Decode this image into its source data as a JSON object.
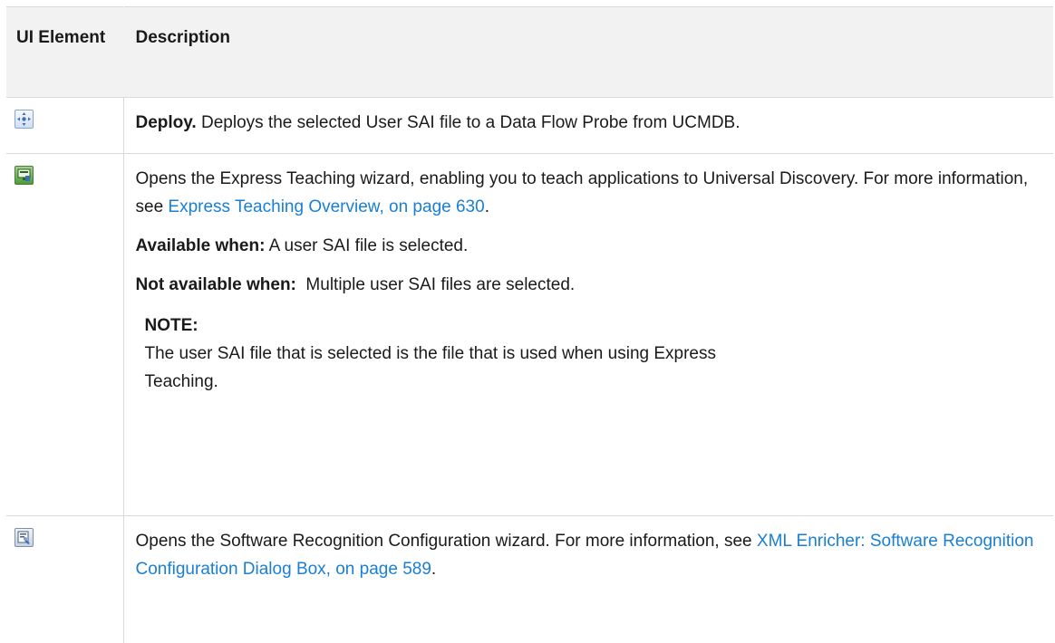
{
  "header": {
    "ui_element": "UI Element",
    "description": "Description"
  },
  "rows": [
    {
      "icon": "deploy-icon",
      "title": "Deploy.",
      "text": " Deploys the selected User SAI file to a Data Flow Probe from UCMDB."
    },
    {
      "icon": "express-teaching-icon",
      "intro": "Opens the Express Teaching wizard, enabling you to teach applications to Universal Discovery. For more information, see ",
      "link": "Express Teaching Overview, on page 630",
      "intro_end": ".",
      "available_label": "Available when:",
      "available_text": " A user SAI file is selected.",
      "not_available_label": "Not available when:",
      "not_available_text": "  Multiple user SAI files are selected.",
      "note_title": "NOTE:",
      "note_text": "The user SAI file that is selected is the file that is used when using Express Teaching."
    },
    {
      "icon": "software-recognition-config-icon",
      "intro": "Opens the Software Recognition Configuration wizard. For more information, see ",
      "link": "XML Enricher: Software Recognition Configuration Dialog Box, on page 589",
      "intro_end": "."
    }
  ],
  "colors": {
    "link": "#1a7fd4",
    "header_bg": "#f2f2f2",
    "border": "#d9d9d9"
  }
}
